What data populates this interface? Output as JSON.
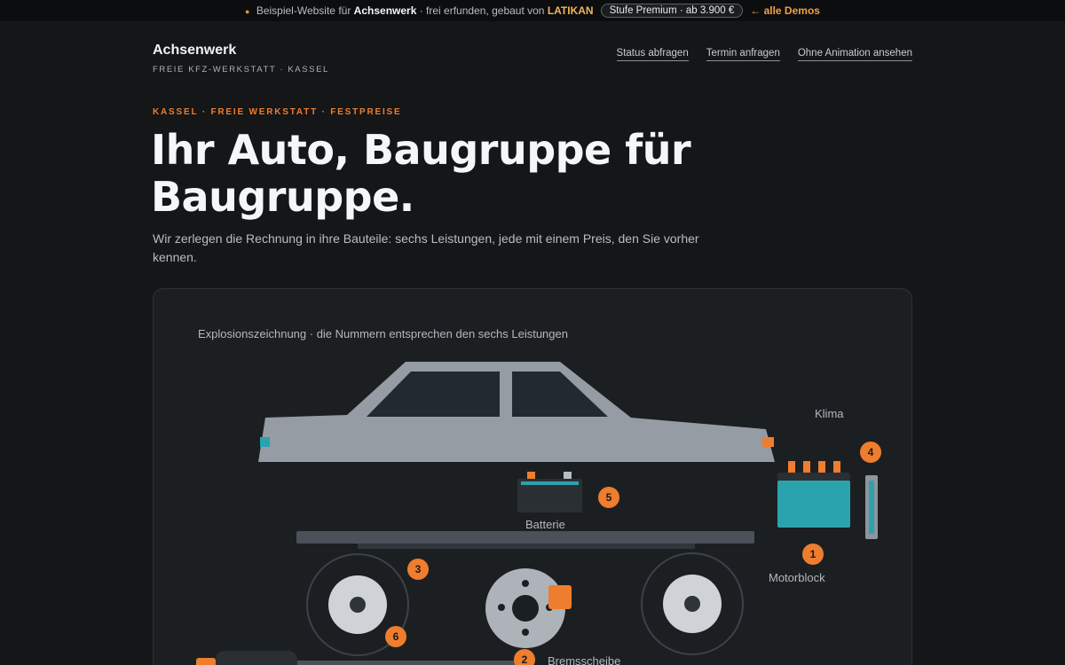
{
  "topbar": {
    "prefix": "Beispiel-Website für",
    "site": "Achsenwerk",
    "middle": "· frei erfunden, gebaut von",
    "maker": "LATIKAN",
    "pill": "Stufe Premium · ab 3.900 €",
    "demos_link": "← alle Demos"
  },
  "header": {
    "logo": "Achsenwerk",
    "tagline": "FREIE KFZ-WERKSTATT · KASSEL",
    "nav": [
      "Status abfragen",
      "Termin anfragen",
      "Ohne Animation ansehen"
    ]
  },
  "hero": {
    "kicker": "KASSEL · FREIE WERKSTATT · FESTPREISE",
    "title": "Ihr Auto, Baugruppe für Baugruppe.",
    "lead": "Wir zerlegen die Rechnung in ihre Bauteile: sechs Leistungen, jede mit einem Preis, den Sie vorher kennen."
  },
  "diagram": {
    "caption": "Explosionszeichnung · die Nummern entsprechen den sechs Leistungen",
    "labels": {
      "klima": "Klima",
      "batterie": "Batterie",
      "motorblock": "Motorblock",
      "bremsscheibe": "Bremsscheibe"
    },
    "badges": [
      "1",
      "2",
      "3",
      "4",
      "5",
      "6"
    ]
  },
  "colors": {
    "accent": "#ef7d2e",
    "teal": "#2ba3ad",
    "car_body": "#959ca4",
    "background": "#141617",
    "panel": "#1c1f22"
  }
}
